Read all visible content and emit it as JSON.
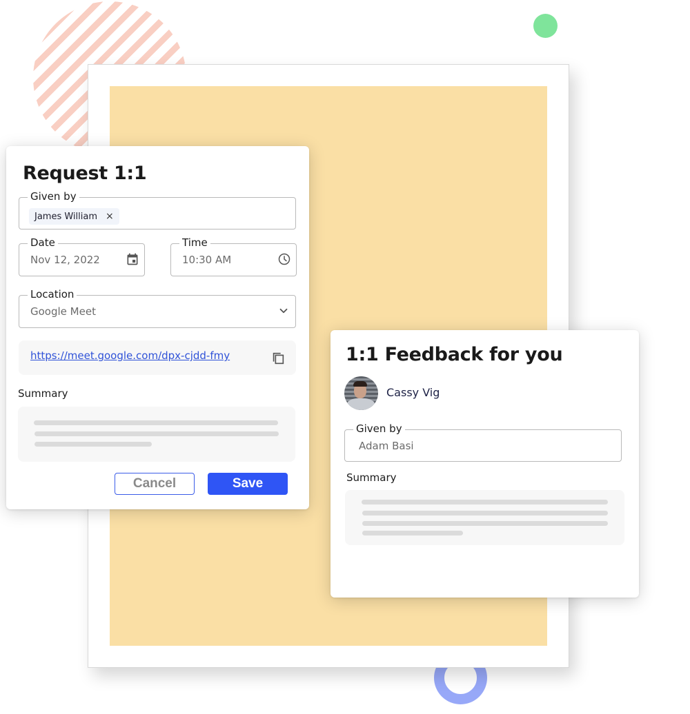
{
  "decorations": {
    "stripe_color": "#f9cfc3",
    "green_dot_color": "#7fe49b",
    "ring_color": "#97a8f8",
    "frame_fill_color": "#fadfa5"
  },
  "request_card": {
    "title": "Request 1:1",
    "given_by": {
      "label": "Given by",
      "chips": [
        {
          "label": "James William",
          "remove_icon": "×"
        }
      ]
    },
    "date": {
      "label": "Date",
      "value": "Nov 12, 2022",
      "icon": "calendar-icon"
    },
    "time": {
      "label": "Time",
      "value": "10:30 AM",
      "icon": "clock-icon"
    },
    "location": {
      "label": "Location",
      "value": "Google Meet",
      "icon": "chevron-down-icon"
    },
    "meeting_link": {
      "url": "https://meet.google.com/dpx-cjdd-fmy",
      "icon": "copy-icon"
    },
    "summary_label": "Summary",
    "buttons": {
      "cancel": "Cancel",
      "save": "Save"
    },
    "accent_color": "#2f55f5"
  },
  "feedback_card": {
    "title": "1:1 Feedback for you",
    "person": {
      "name": "Cassy Vig",
      "avatar": "avatar-photo"
    },
    "given_by": {
      "label": "Given by",
      "value": "Adam Basi"
    },
    "summary_label": "Summary"
  }
}
